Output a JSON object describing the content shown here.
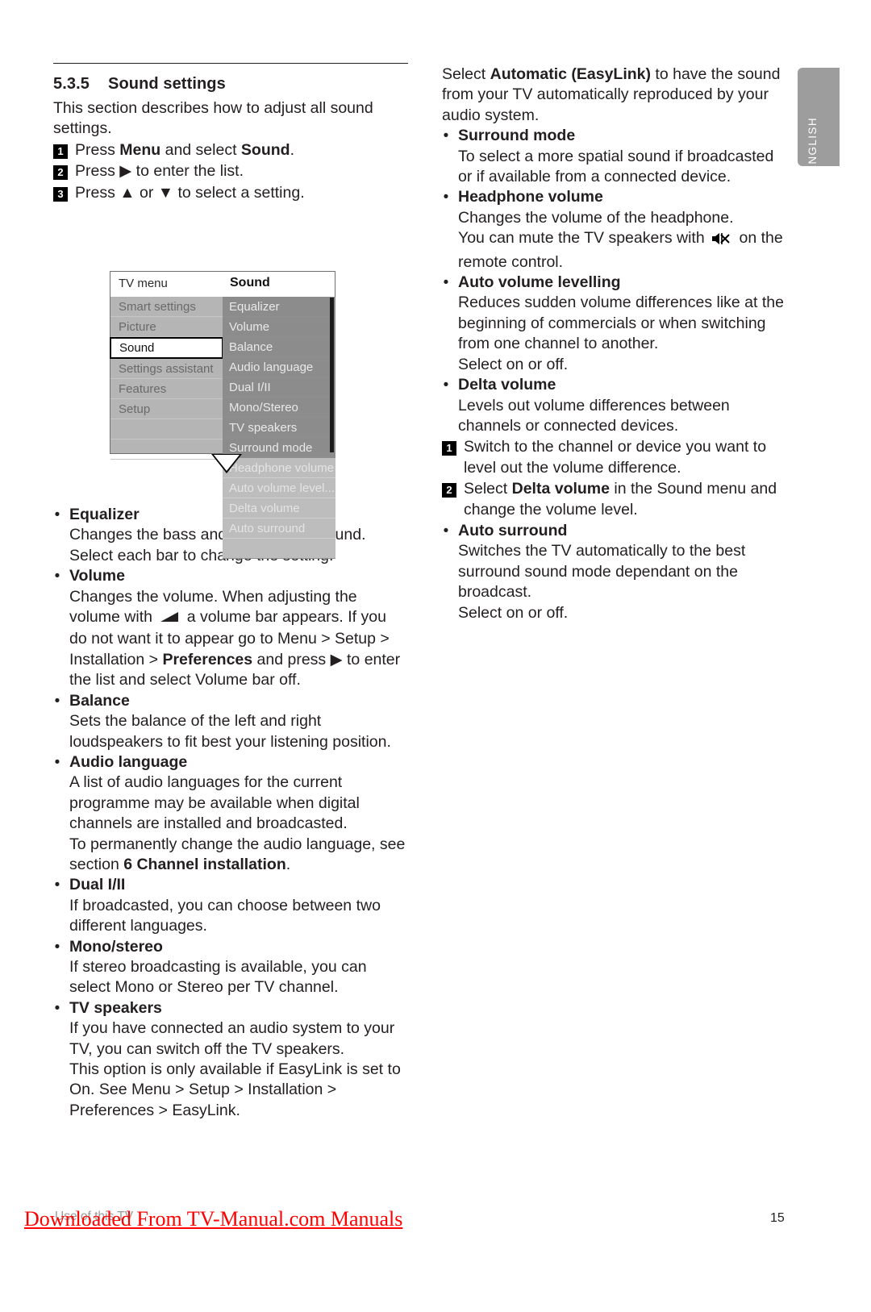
{
  "page": {
    "language_tab": "ENGLISH",
    "page_number": "15",
    "footer_note": "Use of this TV",
    "footer_watermark": "Downloaded From TV-Manual.com Manuals"
  },
  "section": {
    "number": "5.3.5",
    "title": "Sound settings",
    "intro": "This section describes how to adjust all sound settings.",
    "steps": [
      {
        "num": "1",
        "html": "Press <b>Menu</b> and select <b>Sound</b>."
      },
      {
        "num": "2",
        "html": "Press ▶ to enter the list."
      },
      {
        "num": "3",
        "html": "Press ▲ or ▼ to select a setting."
      }
    ]
  },
  "tv_menu": {
    "header_left": "TV menu",
    "header_right": "Sound",
    "left_items": [
      {
        "label": "Smart settings",
        "selected": false
      },
      {
        "label": "Picture",
        "selected": false
      },
      {
        "label": "Sound",
        "selected": true
      },
      {
        "label": "Settings assistant",
        "selected": false
      },
      {
        "label": "Features",
        "selected": false
      },
      {
        "label": "Setup",
        "selected": false
      },
      {
        "label": "",
        "selected": false
      },
      {
        "label": "",
        "selected": false
      }
    ],
    "right_items": [
      {
        "label": "Equalizer",
        "state": "dark"
      },
      {
        "label": "Volume",
        "state": "dark"
      },
      {
        "label": "Balance",
        "state": "dark"
      },
      {
        "label": "Audio language",
        "state": "dark"
      },
      {
        "label": "Dual I/II",
        "state": "dark"
      },
      {
        "label": "Mono/Stereo",
        "state": "dark"
      },
      {
        "label": "TV speakers",
        "state": "dark"
      },
      {
        "label": "Surround mode",
        "state": "dark"
      },
      {
        "label": "Headphone volume",
        "state": "light"
      },
      {
        "label": "Auto volume level...",
        "state": "light"
      },
      {
        "label": "Delta volume",
        "state": "light"
      },
      {
        "label": "Auto surround",
        "state": "light"
      },
      {
        "label": "",
        "state": "empty"
      }
    ]
  },
  "left_bullets": [
    {
      "head": "Equalizer",
      "body_html": "Changes the bass and treble of the sound. Select each bar to change the setting."
    },
    {
      "head": "Volume",
      "body_html": "Changes the volume. When adjusting the volume with <span class=\"ico-vol\" data-name=\"volume-icon\"><svg width=\"26\" height=\"15\" viewBox=\"0 0 26 15\"><polygon points=\"2,13 24,1 24,13\" fill=\"#231f20\"/></svg></span> a volume bar appears. If you do not want it to appear go to Menu &gt; Setup &gt; Installation &gt; <b>Preferences</b> and press ▶ to enter the list and select Volume bar off."
    },
    {
      "head": "Balance",
      "body_html": "Sets the balance of the left and right loudspeakers to fit best your listening position."
    },
    {
      "head": "Audio language",
      "body_html": "A list of audio languages for the current programme may be available when digital channels are installed and broadcasted.<br>To permanently change the audio language, see section <b>6 Channel installation</b>."
    },
    {
      "head": "Dual I/II",
      "body_html": "If broadcasted, you can choose between two different languages."
    },
    {
      "head": "Mono/stereo",
      "body_html": "If stereo broadcasting is available, you can select Mono or Stereo per TV channel."
    },
    {
      "head": "TV speakers",
      "body_html": "If you have connected an audio system to your TV, you can switch off the TV speakers.<br>This option is only available if EasyLink is set to On. See Menu &gt; Setup &gt; Installation &gt; Preferences &gt; EasyLink."
    }
  ],
  "right_intro_html": "Select <b>Automatic (EasyLink)</b> to have the sound from your TV automatically reproduced by your audio system.",
  "right_bullets": [
    {
      "head": "Surround mode",
      "body_html": "To select a more spatial sound if broadcasted or if available from a connected device."
    },
    {
      "head": "Headphone volume",
      "body_html": "Changes the volume of the headphone.<br>You can mute the TV speakers with <span class=\"ico-mute\" data-name=\"mute-icon\"><svg width=\"26\" height=\"18\" viewBox=\"0 0 26 18\"><polygon points=\"1,6 5,6 10,2 10,16 5,12 1,12\" fill=\"#000\"/><path d=\"M12 4 L22 14 M22 4 L12 14\" stroke=\"#000\" stroke-width=\"2\" fill=\"none\"/><path d=\"M13 2 L13 16\" stroke=\"#000\" stroke-width=\"1.6\"/></svg></span> on the remote control."
    },
    {
      "head": "Auto volume levelling",
      "body_html": "Reduces sudden volume differences like at the beginning of commercials or when switching from one channel to another.<br>Select on or off."
    },
    {
      "head": "Delta volume",
      "body_html": "Levels out volume differences between channels or connected devices."
    }
  ],
  "right_steps": [
    {
      "num": "1",
      "html": "Switch to the channel or device you want to level out the volume difference."
    },
    {
      "num": "2",
      "html": "Select <b>Delta volume</b> in the Sound menu and change the volume level."
    }
  ],
  "right_last_bullet": {
    "head": "Auto surround",
    "body_html": "Switches the TV automatically to the best surround sound mode dependant on the broadcast.<br>Select on or off."
  }
}
